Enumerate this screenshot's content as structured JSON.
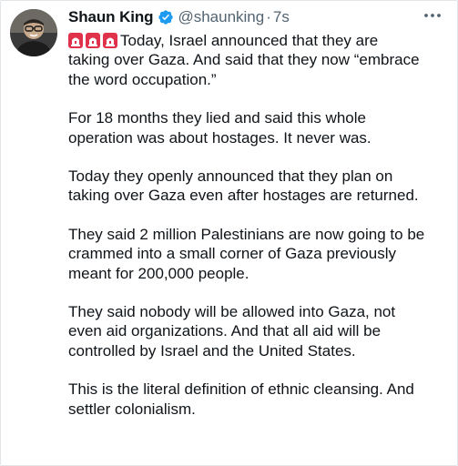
{
  "tweet": {
    "author": {
      "display_name": "Shaun King",
      "handle": "@shaunking",
      "separator": "·",
      "timestamp": "7s",
      "verified": true,
      "avatar_icon": "person-avatar"
    },
    "lead_icons": [
      "siren-icon",
      "siren-icon",
      "siren-icon"
    ],
    "lead_text": "Today, Israel announced that they are",
    "first_paragraph_rest": "taking over Gaza. And said that they now “embrace\nthe word occupation.”",
    "paragraphs": [
      "For 18 months they lied and said this whole\noperation was about hostages. It never was.",
      "Today they openly announced that they plan on\ntaking over Gaza even after hostages are returned.",
      "They said 2 million Palestinians are now going to be\ncrammed into a small corner of Gaza previously\nmeant for 200,000 people.",
      "They said nobody will be allowed into Gaza, not\neven aid organizations. And that all aid will be\ncontrolled by Israel and the United States.",
      "This is the literal definition of ethnic cleansing. And\nsettler colonialism."
    ]
  },
  "colors": {
    "text": "#0f1419",
    "secondary": "#536471",
    "verified_blue": "#1d9bf0",
    "siren_red": "#e0324a"
  }
}
